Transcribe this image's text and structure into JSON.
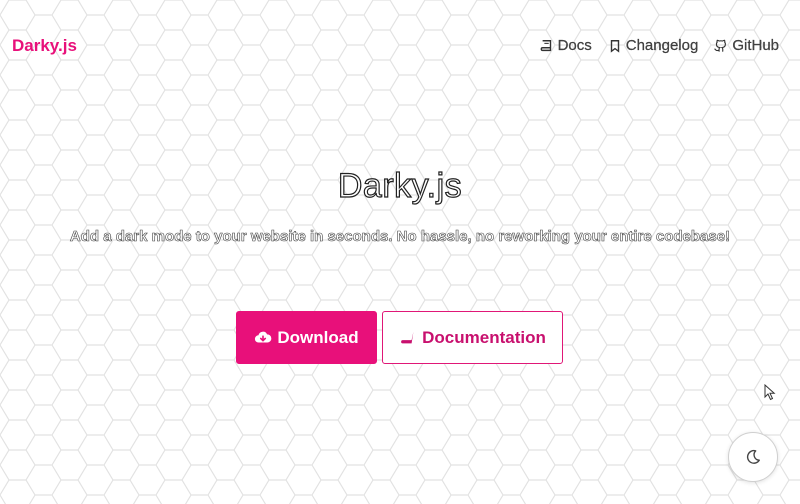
{
  "navbar": {
    "brand": "Darky.js",
    "links": [
      {
        "label": "Docs",
        "icon": "book-icon"
      },
      {
        "label": "Changelog",
        "icon": "bookmark-icon"
      },
      {
        "label": "GitHub",
        "icon": "github-icon"
      }
    ]
  },
  "hero": {
    "title": "Darky.js",
    "subtitle": "Add a dark mode to your website in seconds. No hassle, no reworking your entire codebase!"
  },
  "buttons": {
    "download_label": "Download",
    "download_icon": "cloud-download-icon",
    "documentation_label": "Documentation",
    "documentation_icon": "book-icon"
  },
  "theme_toggle": {
    "icon": "moon-icon"
  },
  "colors": {
    "accent": "#e8107a",
    "background": "#ffffff",
    "pattern": "#e2e2e2"
  }
}
